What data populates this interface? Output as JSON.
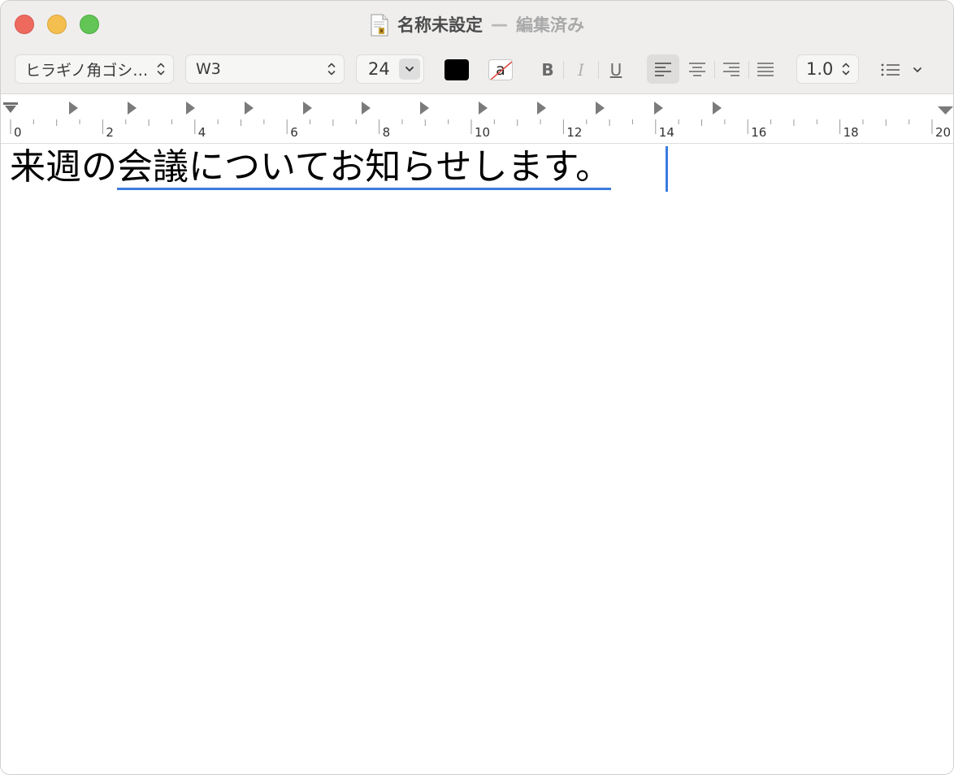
{
  "window": {
    "title": "名称未設定",
    "separator": "—",
    "status": "編集済み"
  },
  "toolbar": {
    "font_family": "ヒラギノ角ゴシ…",
    "font_style": "W3",
    "font_size": "24",
    "text_color": "#000000",
    "bold_label": "B",
    "italic_label": "I",
    "underline_label": "U",
    "bg_color_glyph": "a",
    "line_spacing": "1.0"
  },
  "ruler": {
    "labels": [
      "0",
      "2",
      "4",
      "6",
      "8",
      "10",
      "12",
      "14",
      "16",
      "18",
      "20"
    ]
  },
  "document": {
    "plain_text": "来週の",
    "marked_text": "会議についてお知らせします。"
  },
  "colors": {
    "accent": "#3b7be0",
    "close": "#ee6a5f",
    "minimize": "#f5bf4f",
    "maximize": "#62c555"
  }
}
